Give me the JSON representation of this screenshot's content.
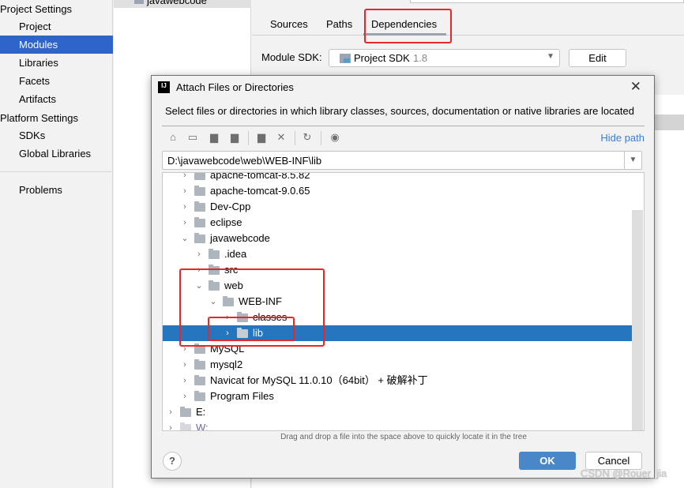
{
  "sidebar": {
    "project_settings": "Project Settings",
    "project_items": [
      "Project",
      "Modules",
      "Libraries",
      "Facets",
      "Artifacts"
    ],
    "platform_settings": "Platform Settings",
    "platform_items": [
      "SDKs",
      "Global Libraries"
    ],
    "problems": "Problems",
    "selected": "Modules"
  },
  "module_tree": {
    "item": "javawebcode"
  },
  "tabs": [
    "Sources",
    "Paths",
    "Dependencies"
  ],
  "active_tab": "Dependencies",
  "sdk": {
    "label": "Module SDK:",
    "value": "Project SDK",
    "version": "1.8",
    "edit": "Edit"
  },
  "dialog": {
    "title": "Attach Files or Directories",
    "logo": "IJ",
    "description": "Select files or directories in which library classes, sources, documentation or native libraries are located",
    "hide_path": "Hide path",
    "path": "D:\\javawebcode\\web\\WEB-INF\\lib",
    "toolbar_icons": [
      "home-icon",
      "desktop-icon",
      "project-folder-icon",
      "module-folder-icon",
      "new-folder-icon",
      "delete-icon",
      "refresh-icon",
      "show-hidden-icon"
    ],
    "tree": [
      {
        "label": "apache-tomcat-8.5.82",
        "level": 1,
        "expanded": false
      },
      {
        "label": "apache-tomcat-9.0.65",
        "level": 1,
        "expanded": false
      },
      {
        "label": "Dev-Cpp",
        "level": 1,
        "expanded": false
      },
      {
        "label": "eclipse",
        "level": 1,
        "expanded": false
      },
      {
        "label": "javawebcode",
        "level": 1,
        "expanded": true
      },
      {
        "label": ".idea",
        "level": 2,
        "expanded": false
      },
      {
        "label": "src",
        "level": 2,
        "expanded": false
      },
      {
        "label": "web",
        "level": 2,
        "expanded": true
      },
      {
        "label": "WEB-INF",
        "level": 3,
        "expanded": true
      },
      {
        "label": "classes",
        "level": 4,
        "expanded": false
      },
      {
        "label": "lib",
        "level": 4,
        "expanded": false,
        "selected": true
      },
      {
        "label": "MySQL",
        "level": 1,
        "expanded": false
      },
      {
        "label": "mysql2",
        "level": 1,
        "expanded": false
      },
      {
        "label": "Navicat for MySQL 11.0.10（64bit） + 破解补丁",
        "level": 1,
        "expanded": false
      },
      {
        "label": "Program Files",
        "level": 1,
        "expanded": false
      },
      {
        "label": "E:",
        "level": 0,
        "expanded": false
      },
      {
        "label": "W:",
        "level": 0,
        "expanded": false,
        "dimmed": true
      }
    ],
    "hint": "Drag and drop a file into the space above to quickly locate it in the tree",
    "ok": "OK",
    "cancel": "Cancel",
    "help": "?"
  },
  "watermark": "CSDN @Rouer_jia",
  "colors": {
    "selection": "#2675bf",
    "sidebar_selection": "#2f65ca",
    "ok_button": "#4a87c8",
    "link": "#3d7dd0",
    "annotation_red": "#e8272a"
  }
}
